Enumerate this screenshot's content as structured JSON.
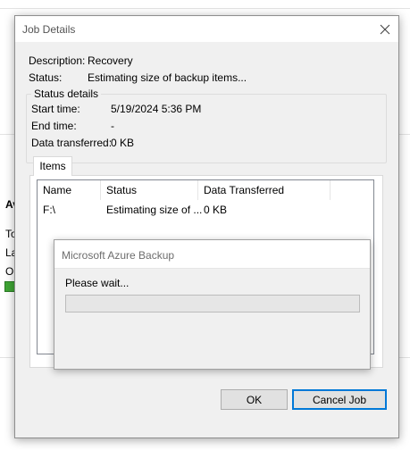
{
  "background": {
    "heading_fragment": "Av",
    "line1_fragment": "To",
    "line2_fragment": "La",
    "line3_fragment": "Ol"
  },
  "dialog": {
    "title": "Job Details",
    "description_label": "Description:",
    "description_value": "Recovery",
    "status_label": "Status:",
    "status_value": "Estimating size of backup items...",
    "status_details": {
      "legend": "Status details",
      "start_time_label": "Start time:",
      "start_time_value": "5/19/2024 5:36 PM",
      "end_time_label": "End time:",
      "end_time_value": "-",
      "data_transferred_label": "Data transferred:",
      "data_transferred_value": "0 KB"
    },
    "tabs": [
      {
        "label": "Items",
        "selected": true
      }
    ],
    "items_table": {
      "columns": [
        "Name",
        "Status",
        "Data Transferred"
      ],
      "rows": [
        {
          "name": "F:\\",
          "status": "Estimating size of ...",
          "data_transferred": "0 KB"
        }
      ]
    },
    "ok_label": "OK",
    "cancel_job_label": "Cancel Job"
  },
  "wait_dialog": {
    "title": "Microsoft Azure Backup",
    "message": "Please wait...",
    "progress": 0
  },
  "colors": {
    "accent": "#0078d7",
    "dialog_bg": "#f0f0f0",
    "status_green": "#3fa535"
  },
  "icons": [
    "close-icon"
  ]
}
